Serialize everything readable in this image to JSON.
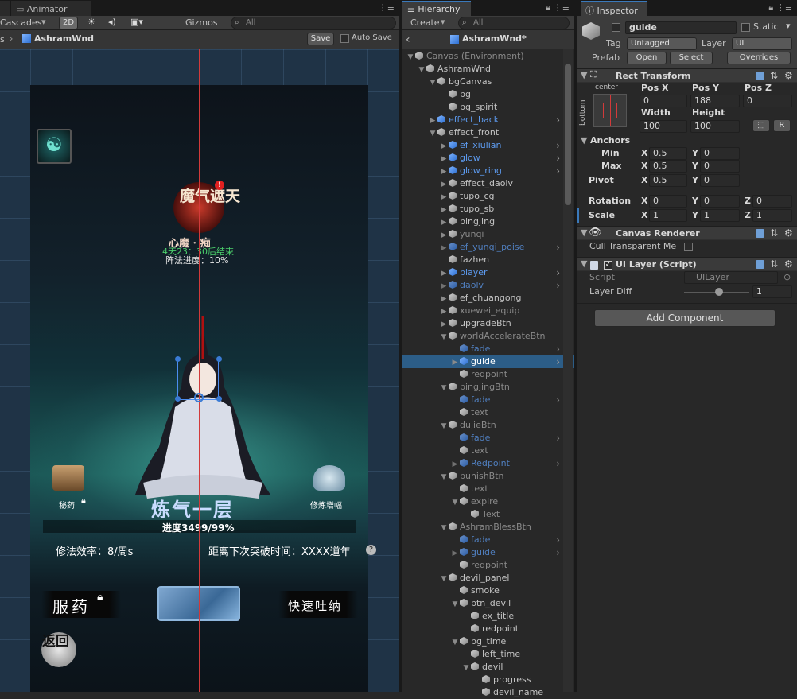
{
  "scene_panel": {
    "tab_label": "Animator",
    "toolbar": {
      "cascades": "Cascades",
      "mode_2d": "2D",
      "gizmos": "Gizmos",
      "search_placeholder": "All"
    },
    "breadcrumb": {
      "prefix": "s",
      "asset": "AshramWnd",
      "save": "Save",
      "auto_save": "Auto Save"
    }
  },
  "game": {
    "top_badge_title": "魔气遮天",
    "devil_name": "心魔 · 痴",
    "timer": "4天23：30后结束",
    "progress_text": "阵法进度：10%",
    "left_item": "秘药",
    "right_item": "修炼增幅",
    "realm": "炼气一层",
    "progress_bar": "进度3499/99%",
    "efficiency": "修法效率：8/周s",
    "next_breakthrough": "距离下次突破时间：XXXX道年",
    "take_medicine": "服药",
    "fast_breath": "快速吐纳",
    "back": "返回"
  },
  "hierarchy": {
    "tab_label": "Hierarchy",
    "create": "Create",
    "search_placeholder": "All",
    "scene_title": "AshramWnd*",
    "rows": [
      {
        "label": "Canvas (Environment)",
        "depth": 0,
        "style": "gray",
        "arrow": "▼"
      },
      {
        "label": "AshramWnd",
        "depth": 1,
        "style": "",
        "arrow": "▼"
      },
      {
        "label": "bgCanvas",
        "depth": 2,
        "style": "",
        "arrow": "▼"
      },
      {
        "label": "bg",
        "depth": 3,
        "style": "",
        "arrow": ""
      },
      {
        "label": "bg_spirit",
        "depth": 3,
        "style": "",
        "arrow": ""
      },
      {
        "label": "effect_back",
        "depth": 2,
        "style": "blue",
        "arrow": "▶",
        "right": true
      },
      {
        "label": "effect_front",
        "depth": 2,
        "style": "",
        "arrow": "▼"
      },
      {
        "label": "ef_xiulian",
        "depth": 3,
        "style": "blue",
        "arrow": "▶",
        "right": true
      },
      {
        "label": "glow",
        "depth": 3,
        "style": "blue",
        "arrow": "▶",
        "right": true
      },
      {
        "label": "glow_ring",
        "depth": 3,
        "style": "blue",
        "arrow": "▶",
        "right": true
      },
      {
        "label": "effect_daolv",
        "depth": 3,
        "style": "",
        "arrow": "▶"
      },
      {
        "label": "tupo_cg",
        "depth": 3,
        "style": "",
        "arrow": "▶"
      },
      {
        "label": "tupo_sb",
        "depth": 3,
        "style": "",
        "arrow": "▶"
      },
      {
        "label": "pingjing",
        "depth": 3,
        "style": "",
        "arrow": "▶"
      },
      {
        "label": "yunqi",
        "depth": 3,
        "style": "gray",
        "arrow": "▶"
      },
      {
        "label": "ef_yunqi_poise",
        "depth": 3,
        "style": "blue-dim",
        "arrow": "▶",
        "right": true
      },
      {
        "label": "fazhen",
        "depth": 3,
        "style": "",
        "arrow": ""
      },
      {
        "label": "player",
        "depth": 3,
        "style": "blue",
        "arrow": "▶",
        "right": true
      },
      {
        "label": "daolv",
        "depth": 3,
        "style": "blue-dim",
        "arrow": "▶",
        "right": true
      },
      {
        "label": "ef_chuangong",
        "depth": 3,
        "style": "",
        "arrow": "▶"
      },
      {
        "label": "xuewei_equip",
        "depth": 3,
        "style": "gray",
        "arrow": "▶"
      },
      {
        "label": "upgradeBtn",
        "depth": 3,
        "style": "",
        "arrow": "▶"
      },
      {
        "label": "worldAccelerateBtn",
        "depth": 3,
        "style": "gray",
        "arrow": "▼"
      },
      {
        "label": "fade",
        "depth": 4,
        "style": "blue-dim",
        "arrow": "",
        "right": true
      },
      {
        "label": "guide",
        "depth": 4,
        "style": "sel",
        "arrow": "▶",
        "right": true
      },
      {
        "label": "redpoint",
        "depth": 4,
        "style": "gray",
        "arrow": ""
      },
      {
        "label": "pingjingBtn",
        "depth": 3,
        "style": "gray",
        "arrow": "▼"
      },
      {
        "label": "fade",
        "depth": 4,
        "style": "blue-dim",
        "arrow": "",
        "right": true
      },
      {
        "label": "text",
        "depth": 4,
        "style": "gray",
        "arrow": ""
      },
      {
        "label": "dujieBtn",
        "depth": 3,
        "style": "gray",
        "arrow": "▼"
      },
      {
        "label": "fade",
        "depth": 4,
        "style": "blue-dim",
        "arrow": "",
        "right": true
      },
      {
        "label": "text",
        "depth": 4,
        "style": "gray",
        "arrow": ""
      },
      {
        "label": "Redpoint",
        "depth": 4,
        "style": "blue-dim",
        "arrow": "▶",
        "right": true
      },
      {
        "label": "punishBtn",
        "depth": 3,
        "style": "gray",
        "arrow": "▼"
      },
      {
        "label": "text",
        "depth": 4,
        "style": "gray",
        "arrow": ""
      },
      {
        "label": "expire",
        "depth": 4,
        "style": "gray",
        "arrow": "▼"
      },
      {
        "label": "Text",
        "depth": 5,
        "style": "gray",
        "arrow": ""
      },
      {
        "label": "AshramBlessBtn",
        "depth": 3,
        "style": "gray",
        "arrow": "▼"
      },
      {
        "label": "fade",
        "depth": 4,
        "style": "blue-dim",
        "arrow": "",
        "right": true
      },
      {
        "label": "guide",
        "depth": 4,
        "style": "blue-dim",
        "arrow": "▶",
        "right": true
      },
      {
        "label": "redpoint",
        "depth": 4,
        "style": "gray",
        "arrow": ""
      },
      {
        "label": "devil_panel",
        "depth": 3,
        "style": "",
        "arrow": "▼"
      },
      {
        "label": "smoke",
        "depth": 4,
        "style": "",
        "arrow": ""
      },
      {
        "label": "btn_devil",
        "depth": 4,
        "style": "",
        "arrow": "▼"
      },
      {
        "label": "ex_title",
        "depth": 5,
        "style": "",
        "arrow": ""
      },
      {
        "label": "redpoint",
        "depth": 5,
        "style": "",
        "arrow": ""
      },
      {
        "label": "bg_time",
        "depth": 4,
        "style": "",
        "arrow": "▼"
      },
      {
        "label": "left_time",
        "depth": 5,
        "style": "",
        "arrow": ""
      },
      {
        "label": "devil",
        "depth": 5,
        "style": "",
        "arrow": "▼"
      },
      {
        "label": "progress",
        "depth": 6,
        "style": "",
        "arrow": ""
      },
      {
        "label": "devil_name",
        "depth": 6,
        "style": "",
        "arrow": ""
      }
    ]
  },
  "inspector": {
    "tab_label": "Inspector",
    "object_name": "guide",
    "static_label": "Static",
    "tag_label": "Tag",
    "tag_value": "Untagged",
    "layer_label": "Layer",
    "layer_value": "UI",
    "prefab_label": "Prefab",
    "open": "Open",
    "select": "Select",
    "overrides": "Overrides",
    "rect_transform": {
      "title": "Rect Transform",
      "anchor_h": "center",
      "anchor_v": "bottom",
      "pos_x_label": "Pos X",
      "pos_y_label": "Pos Y",
      "pos_z_label": "Pos Z",
      "pos_x": "0",
      "pos_y": "188",
      "pos_z": "0",
      "width_label": "Width",
      "height_label": "Height",
      "width": "100",
      "height": "100",
      "r_btn": "R",
      "anchors_label": "Anchors",
      "min_label": "Min",
      "max_label": "Max",
      "pivot_label": "Pivot",
      "min_x": "0.5",
      "min_y": "0",
      "max_x": "0.5",
      "max_y": "0",
      "pivot_x": "0.5",
      "pivot_y": "0",
      "rotation_label": "Rotation",
      "rot_x": "0",
      "rot_y": "0",
      "rot_z": "0",
      "scale_label": "Scale",
      "scale_x": "1",
      "scale_y": "1",
      "scale_z": "1",
      "x": "X",
      "y": "Y",
      "z": "Z"
    },
    "canvas_renderer": {
      "title": "Canvas Renderer",
      "cull_label": "Cull Transparent Me"
    },
    "ui_layer": {
      "title": "UI Layer (Script)",
      "script_label": "Script",
      "script_value": "UILayer",
      "diff_label": "Layer Diff",
      "diff_value": "1"
    },
    "add_component": "Add Component"
  }
}
